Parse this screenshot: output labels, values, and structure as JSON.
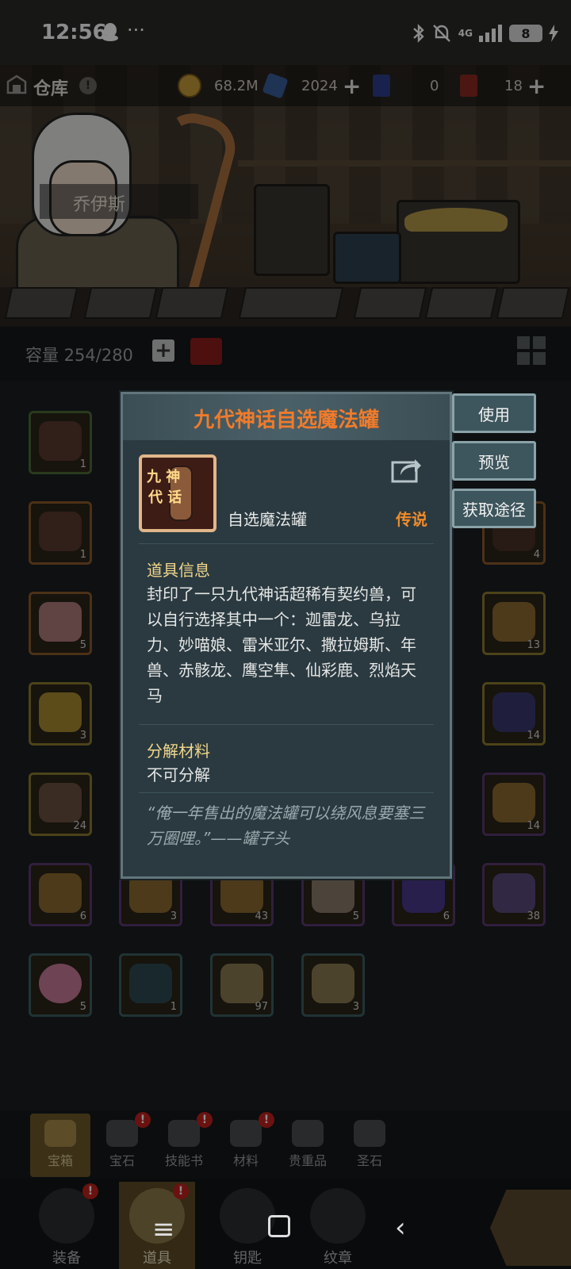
{
  "status_bar": {
    "time": "12:56",
    "dots": "···",
    "network": "4G",
    "battery": "8"
  },
  "scene": {
    "hero_name": "乔伊斯"
  },
  "header": {
    "title": "仓库",
    "help": "!",
    "gold": "68.2M",
    "crystals": "2024",
    "blue_card": "0",
    "red_card": "18"
  },
  "capacity": {
    "text": "容量 254/280"
  },
  "inventory": {
    "counts": {
      "r1c1": "1",
      "r2c1": "1",
      "r2c6": "4",
      "r3c1": "5",
      "r3c6": "13",
      "r4c1": "3",
      "r4c6": "14",
      "r5c1": "24",
      "r5c6": "14",
      "r6c1": "6",
      "r6c2": "3",
      "r6c3": "43",
      "r6c4": "5",
      "r6c5": "6",
      "r6c6": "38",
      "r7c1": "5",
      "r7c2": "1",
      "r7c3": "97",
      "r7c4": "3"
    }
  },
  "popup": {
    "title": "九代神话自选魔法罐",
    "item_icon_line1": "九 神",
    "item_icon_line2": "代 话",
    "item_name": "自选魔法罐",
    "rarity": "传说",
    "info_title": "道具信息",
    "info_body": "封印了一只九代神话超稀有契约兽，可以自行选择其中一个：迦雷龙、乌拉力、妙喵娘、雷米亚尔、撒拉姆斯、年兽、赤骸龙、鹰空隼、仙彩鹿、烈焰天马",
    "decompose_title": "分解材料",
    "decompose_body": "不可分解",
    "quote": "“俺一年售出的魔法罐可以绕风息要塞三万圈哩。”——罐子头"
  },
  "actions": {
    "use": "使用",
    "preview": "预览",
    "source": "获取途径"
  },
  "tabs": [
    "宝箱",
    "宝石",
    "技能书",
    "材料",
    "贵重品",
    "圣石"
  ],
  "bottom_nav": [
    "装备",
    "道具",
    "钥匙",
    "纹章"
  ],
  "colors": {
    "title_orange": "#f07b2b",
    "rarity_orange": "#f08a2a",
    "section_gold": "#f2d68a",
    "badge_red": "#c2221e"
  }
}
